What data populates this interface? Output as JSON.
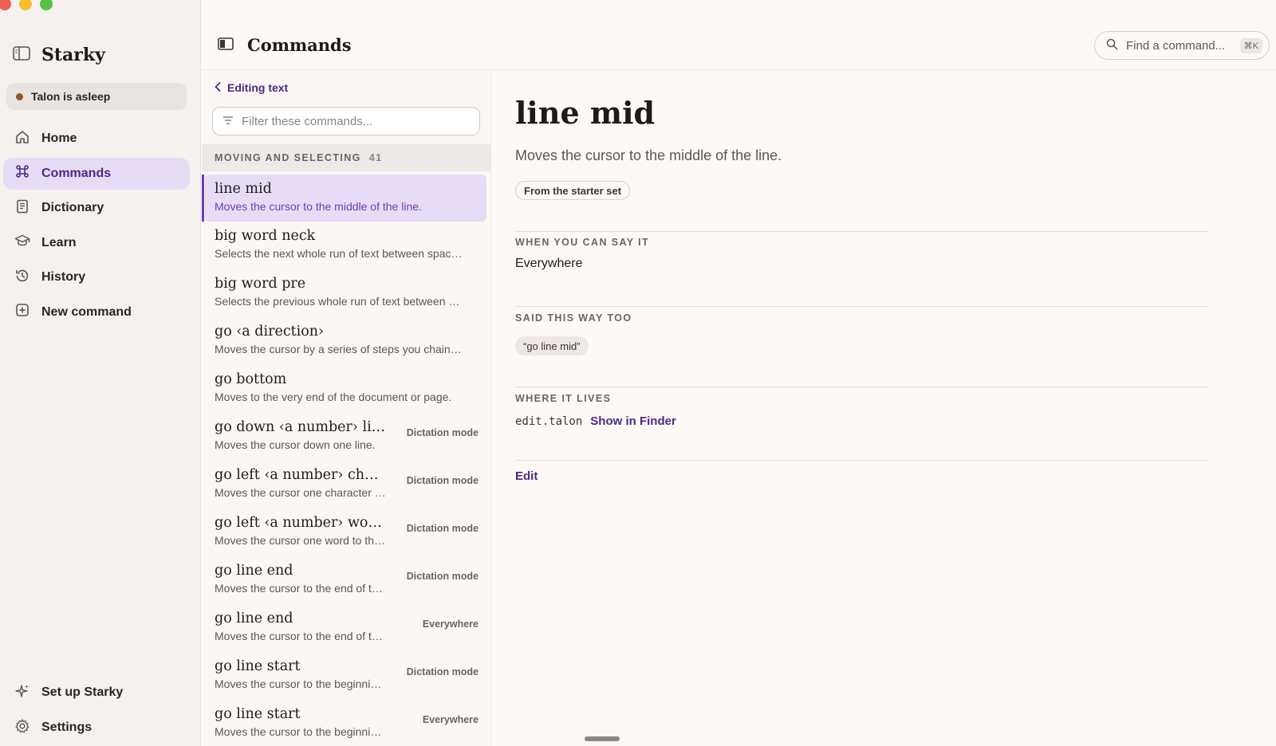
{
  "window": {
    "controls": [
      "close",
      "minimize",
      "zoom"
    ]
  },
  "sidebar": {
    "app_name": "Starky",
    "status": "Talon is asleep",
    "items": [
      {
        "label": "Home",
        "icon": "home-icon",
        "active": false
      },
      {
        "label": "Commands",
        "icon": "command-icon",
        "active": true
      },
      {
        "label": "Dictionary",
        "icon": "book-icon",
        "active": false
      },
      {
        "label": "Learn",
        "icon": "graduation-cap-icon",
        "active": false
      },
      {
        "label": "History",
        "icon": "history-icon",
        "active": false
      },
      {
        "label": "New command",
        "icon": "plus-square-icon",
        "active": false
      }
    ],
    "bottom_items": [
      {
        "label": "Set up Starky",
        "icon": "sparkle-icon"
      },
      {
        "label": "Settings",
        "icon": "gear-icon"
      }
    ]
  },
  "header": {
    "title": "Commands",
    "search_placeholder": "Find a command...",
    "search_shortcut": "⌘K"
  },
  "list": {
    "back_label": "Editing text",
    "filter_placeholder": "Filter these commands...",
    "group_title": "MOVING AND SELECTING",
    "group_count": "41",
    "rows": [
      {
        "title": "line mid",
        "desc": "Moves the cursor to the middle of the line.",
        "badge": ""
      },
      {
        "title": "big word neck",
        "desc": "Selects the next whole run of text between spaces.",
        "badge": ""
      },
      {
        "title": "big word pre",
        "desc": "Selects the previous whole run of text between spaces.",
        "badge": ""
      },
      {
        "title": "go ‹a direction›",
        "desc": "Moves the cursor by a series of steps you chain together.",
        "badge": ""
      },
      {
        "title": "go bottom",
        "desc": "Moves to the very end of the document or page.",
        "badge": ""
      },
      {
        "title": "go down ‹a number› lines",
        "desc": "Moves the cursor down one line.",
        "badge": "Dictation mode"
      },
      {
        "title": "go left ‹a number› characters",
        "desc": "Moves the cursor one character to the left.",
        "badge": "Dictation mode"
      },
      {
        "title": "go left ‹a number› words",
        "desc": "Moves the cursor one word to the left.",
        "badge": "Dictation mode"
      },
      {
        "title": "go line end",
        "desc": "Moves the cursor to the end of the line.",
        "badge": "Dictation mode"
      },
      {
        "title": "go line end",
        "desc": "Moves the cursor to the end of the line.",
        "badge": "Everywhere"
      },
      {
        "title": "go line start",
        "desc": "Moves the cursor to the beginning of the line.",
        "badge": "Dictation mode"
      },
      {
        "title": "go line start",
        "desc": "Moves the cursor to the beginning of the line.",
        "badge": "Everywhere"
      }
    ]
  },
  "detail": {
    "title": "line mid",
    "description": "Moves the cursor to the middle of the line.",
    "tag": "From the starter set",
    "when_label": "WHEN YOU CAN SAY IT",
    "when_value": "Everywhere",
    "alt_label": "SAID THIS WAY TOO",
    "alt_phrase": "“go line mid”",
    "where_label": "WHERE IT LIVES",
    "file": "edit.talon",
    "finder_link": "Show in Finder",
    "edit_link": "Edit"
  },
  "colors": {
    "accent": "#4a2a82",
    "accent_bg": "#e6dcf5",
    "status_dot": "#8a5a2b"
  }
}
